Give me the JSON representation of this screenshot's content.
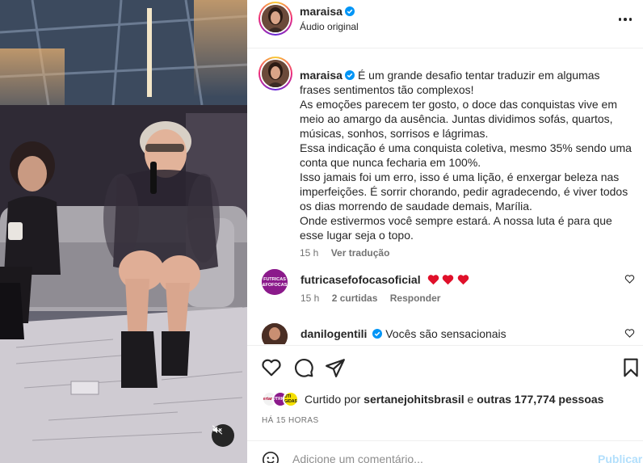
{
  "post": {
    "author": "maraisa",
    "audio_label": "Áudio original",
    "caption": "É um grande desafio tentar traduzir em algumas\nfrases sentimentos tão complexos!\nAs emoções parecem ter gosto, o doce das conquistas vive em\nmeio ao amargo da ausência. Juntas dividimos sofás, quartos,\nmúsicas, sonhos, sorrisos e lágrimas.\nEssa indicação é uma conquista coletiva, mesmo 35% sendo uma\nconta que nunca fecharia em 100%.\nIsso jamais foi um erro, isso é uma lição, é enxergar beleza nas\nimperfeições. É sorrir chorando, pedir agradecendo, é viver todos\nos dias morrendo de saudade demais, Marília.\nOnde estivermos você sempre estará. A nossa luta é para que\nesse lugar seja o topo.",
    "caption_time": "15 h",
    "translate_label": "Ver tradução"
  },
  "comments": [
    {
      "author": "futricasefofocasoficial",
      "text": "",
      "hearts": 3,
      "time": "15 h",
      "likes": "2 curtidas",
      "reply_label": "Responder",
      "avatar_text": "FUTRICAS E FOFOCAS"
    },
    {
      "author": "danilogentili",
      "text": "Vocês são sensacionais"
    }
  ],
  "likes": {
    "prefix": "Curtido por",
    "user": "sertanejohitsbrasil",
    "middle": "e",
    "others": "outras 177,774 pessoas",
    "avatars": [
      {
        "label": "sertanejo",
        "bg": "#f2f2f2",
        "color": "#b3002d"
      },
      {
        "label": "FUTRICAS",
        "bg": "#8b1a8b",
        "color": "#ffffff"
      },
      {
        "label": "UTI GIDAS",
        "bg": "#f5e000",
        "color": "#111111"
      }
    ]
  },
  "time_ago": "HÁ 15 HORAS",
  "add_comment": {
    "placeholder": "Adicione um comentário...",
    "publish_label": "Publicar"
  },
  "colors": {
    "text": "#262626",
    "secondary": "#737373",
    "verified": "#0095f6",
    "heart": "#ed4956",
    "publish_disabled": "#b2dffc"
  }
}
